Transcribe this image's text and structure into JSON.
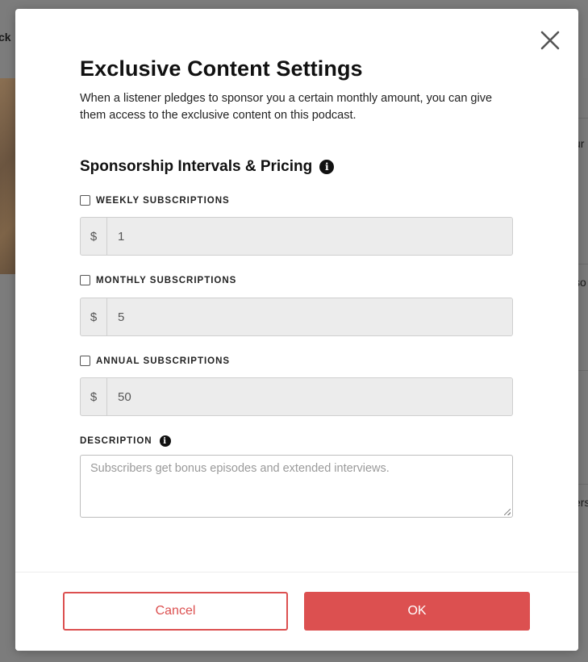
{
  "background": {
    "back_text": "ck",
    "right_texts": [
      "ur",
      "so",
      "ers"
    ]
  },
  "modal": {
    "close_icon": "close-icon",
    "title": "Exclusive Content Settings",
    "description": "When a listener pledges to sponsor you a certain monthly amount, you can give them access to the exclusive content on this podcast.",
    "section_title": "Sponsorship Intervals & Pricing",
    "info_glyph": "i",
    "intervals": [
      {
        "label": "WEEKLY SUBSCRIPTIONS",
        "currency": "$",
        "value": "1",
        "checked": false
      },
      {
        "label": "MONTHLY SUBSCRIPTIONS",
        "currency": "$",
        "value": "5",
        "checked": false
      },
      {
        "label": "ANNUAL SUBSCRIPTIONS",
        "currency": "$",
        "value": "50",
        "checked": false
      }
    ],
    "description_label": "DESCRIPTION",
    "description_placeholder": "Subscribers get bonus episodes and extended interviews.",
    "cancel_label": "Cancel",
    "ok_label": "OK"
  },
  "colors": {
    "accent": "#dc5050",
    "input_disabled_bg": "#ececec",
    "overlay": "#7c7c7c"
  }
}
